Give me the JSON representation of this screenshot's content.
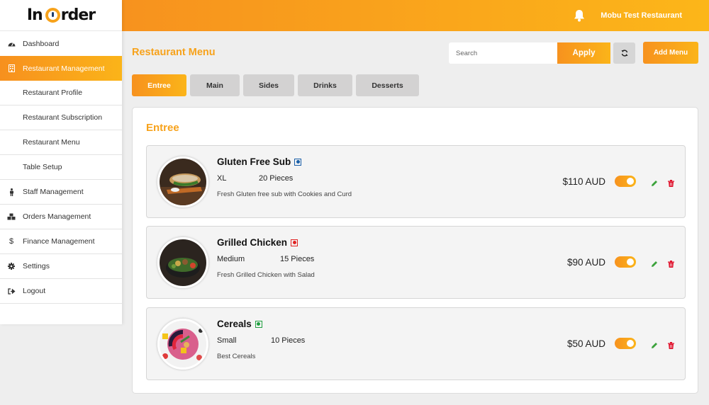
{
  "brand": {
    "logo_left": "In",
    "logo_right": "rder",
    "accent": "#f7a21b"
  },
  "header": {
    "restaurant_name": "Mobu Test Restaurant",
    "bell_icon": "bell-icon"
  },
  "sidebar": {
    "items": [
      {
        "label": "Dashboard",
        "icon": "dashboard-icon"
      },
      {
        "label": "Restaurant Management",
        "icon": "building-icon",
        "active": true
      },
      {
        "label": "Restaurant Profile",
        "sub": true
      },
      {
        "label": "Restaurant Subscription",
        "sub": true
      },
      {
        "label": "Restaurant Menu",
        "sub": true
      },
      {
        "label": "Table Setup",
        "sub": true
      },
      {
        "label": "Staff Management",
        "icon": "person-icon"
      },
      {
        "label": "Orders Management",
        "icon": "cubes-icon"
      },
      {
        "label": "Finance Management",
        "icon": "dollar-icon"
      },
      {
        "label": "Settings",
        "icon": "gear-icon"
      },
      {
        "label": "Logout",
        "icon": "logout-icon"
      }
    ]
  },
  "main": {
    "title": "Restaurant Menu",
    "search": {
      "placeholder": "Search",
      "value": ""
    },
    "apply_label": "Apply",
    "add_label": "Add Menu",
    "tabs": [
      {
        "label": "Entree",
        "active": true
      },
      {
        "label": "Main"
      },
      {
        "label": "Sides"
      },
      {
        "label": "Drinks"
      },
      {
        "label": "Desserts"
      }
    ],
    "section_title": "Entree",
    "items": [
      {
        "name": "Gluten Free Sub",
        "type": "blue",
        "type_color": "#1a5fa8",
        "size": "XL",
        "pieces": "20 Pieces",
        "description": "Fresh Gluten free sub with Cookies and Curd",
        "price": "$110 AUD",
        "enabled": true
      },
      {
        "name": "Grilled Chicken",
        "type": "non-veg",
        "type_color": "#e02424",
        "size": "Medium",
        "pieces": "15 Pieces",
        "description": "Fresh Grilled Chicken with Salad",
        "price": "$90 AUD",
        "enabled": true
      },
      {
        "name": "Cereals",
        "type": "veg",
        "type_color": "#1e9e3e",
        "size": "Small",
        "pieces": "10 Pieces",
        "description": "Best Cereals",
        "price": "$50 AUD",
        "enabled": true
      }
    ]
  }
}
